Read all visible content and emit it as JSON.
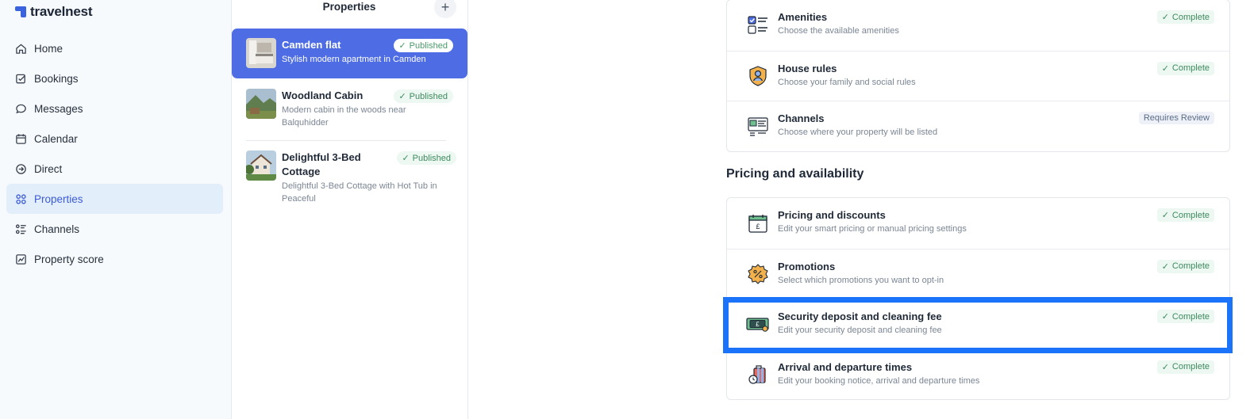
{
  "brand": {
    "name": "travelnest"
  },
  "sidebar": {
    "items": [
      {
        "label": "Home",
        "icon": "home-icon",
        "active": false
      },
      {
        "label": "Bookings",
        "icon": "edit-icon",
        "active": false
      },
      {
        "label": "Messages",
        "icon": "chat-icon",
        "active": false
      },
      {
        "label": "Calendar",
        "icon": "calendar-icon",
        "active": false
      },
      {
        "label": "Direct",
        "icon": "direct-arrow-icon",
        "active": false
      },
      {
        "label": "Properties",
        "icon": "grid-icon",
        "active": true
      },
      {
        "label": "Channels",
        "icon": "list-icon",
        "active": false
      },
      {
        "label": "Property score",
        "icon": "chart-icon",
        "active": false
      }
    ]
  },
  "properties": {
    "title": "Properties",
    "add_label": "+",
    "list": [
      {
        "name": "Camden flat",
        "description": "Stylish modern apartment in Camden",
        "status": "Published",
        "active": true
      },
      {
        "name": "Woodland Cabin",
        "description": "Modern cabin in the woods near Balquhidder",
        "status": "Published",
        "active": false
      },
      {
        "name": "Delightful 3-Bed Cottage",
        "description": "Delightful 3-Bed Cottage with Hot Tub in Peaceful",
        "status": "Published",
        "active": false
      }
    ]
  },
  "listing_section": {
    "rows": [
      {
        "title": "Amenities",
        "description": "Choose the available amenities",
        "status": "Complete",
        "icon": "checklist-icon"
      },
      {
        "title": "House rules",
        "description": "Choose your family and social rules",
        "status": "Complete",
        "icon": "shield-person-icon"
      },
      {
        "title": "Channels",
        "description": "Choose where your property will be listed",
        "status": "Requires Review",
        "icon": "channels-icon"
      }
    ]
  },
  "pricing_section": {
    "title": "Pricing and availability",
    "rows": [
      {
        "title": "Pricing and discounts",
        "description": "Edit your smart pricing or manual pricing settings",
        "status": "Complete",
        "icon": "calendar-pound-icon"
      },
      {
        "title": "Promotions",
        "description": "Select which promotions you want to opt-in",
        "status": "Complete",
        "icon": "percent-badge-icon"
      },
      {
        "title": "Security deposit and cleaning fee",
        "description": "Edit your security deposit and cleaning fee",
        "status": "Complete",
        "icon": "banknote-icon"
      },
      {
        "title": "Arrival and departure times",
        "description": "Edit your booking notice, arrival and departure times",
        "status": "Complete",
        "icon": "luggage-clock-icon"
      }
    ]
  },
  "colors": {
    "accent": "#4e6de4",
    "highlight": "#1a73f8",
    "complete_bg": "#ecf8f1",
    "complete_text": "#3f8a5f"
  }
}
